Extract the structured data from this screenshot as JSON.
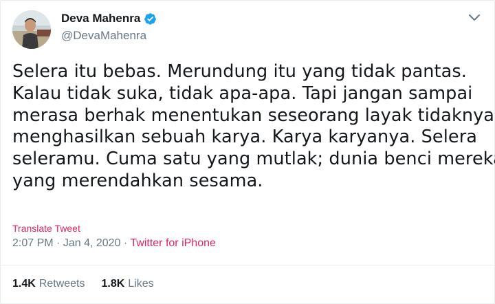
{
  "author": {
    "display_name": "Deva Mahenra",
    "handle": "@DevaMahenra",
    "avatar_icon": "profile-photo",
    "verified_icon": "verified-badge-icon"
  },
  "tweet": {
    "lines": [
      "Selera itu bebas. Merundung itu yang tidak pantas.",
      "Kalau tidak suka, tidak apa-apa. Tapi jangan sampai",
      "merasa berhak menentukan seseorang layak tidaknya",
      "menghasilkan sebuah karya.  Karya karyanya. Selera",
      "seleramu. Cuma satu yang mutlak; dunia benci mereka",
      "yang merendahkan sesama."
    ],
    "translate_label": "Translate Tweet",
    "time": "2:07 PM",
    "date": "Jan 4, 2020",
    "source": "Twitter for iPhone",
    "separator": "·"
  },
  "stats": {
    "retweets_count": "1.4K",
    "retweets_label": "Retweets",
    "likes_count": "1.8K",
    "likes_label": "Likes"
  },
  "colors": {
    "text": "#14171a",
    "muted": "#657786",
    "link": "#e0245e",
    "verified": "#1da1f2",
    "border": "#e6ecf0"
  }
}
